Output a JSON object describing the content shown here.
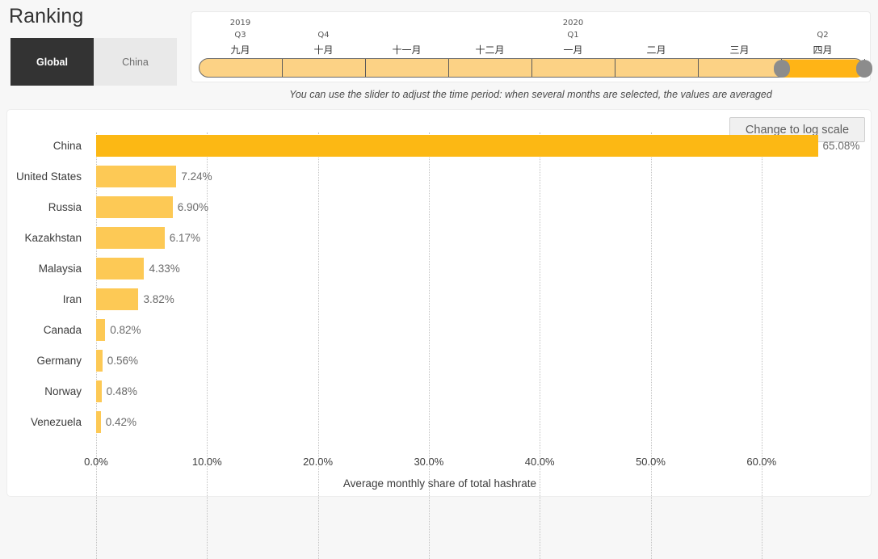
{
  "header": {
    "title": "Ranking"
  },
  "scope_toggle": {
    "options": [
      {
        "label": "Global",
        "active": true
      },
      {
        "label": "China",
        "active": false
      }
    ]
  },
  "timeline": {
    "hint": "You can use the slider to adjust the time period: when several months are selected, the values are averaged",
    "columns": [
      {
        "year": "2019",
        "quarter": "Q3",
        "month": "九月",
        "selected": false
      },
      {
        "year": "",
        "quarter": "Q4",
        "month": "十月",
        "selected": false
      },
      {
        "year": "",
        "quarter": "",
        "month": "十一月",
        "selected": false
      },
      {
        "year": "",
        "quarter": "",
        "month": "十二月",
        "selected": false
      },
      {
        "year": "2020",
        "quarter": "Q1",
        "month": "一月",
        "selected": false
      },
      {
        "year": "",
        "quarter": "",
        "month": "二月",
        "selected": false
      },
      {
        "year": "",
        "quarter": "",
        "month": "三月",
        "selected": false
      },
      {
        "year": "",
        "quarter": "Q2",
        "month": "四月",
        "selected": true
      }
    ]
  },
  "chart_panel": {
    "log_scale_button": "Change to log scale"
  },
  "chart_data": {
    "type": "bar",
    "orientation": "horizontal",
    "title": "",
    "xlabel": "Average monthly share of total hashrate",
    "ylabel": "",
    "categories": [
      "China",
      "United States",
      "Russia",
      "Kazakhstan",
      "Malaysia",
      "Iran",
      "Canada",
      "Germany",
      "Norway",
      "Venezuela"
    ],
    "values": [
      65.08,
      7.24,
      6.9,
      6.17,
      4.33,
      3.82,
      0.82,
      0.56,
      0.48,
      0.42
    ],
    "value_labels": [
      "65.08%",
      "7.24%",
      "6.90%",
      "6.17%",
      "4.33%",
      "3.82%",
      "0.82%",
      "0.56%",
      "0.48%",
      "0.42%"
    ],
    "highlight_index": 0,
    "xlim": [
      0,
      70
    ],
    "xticks": [
      0,
      10,
      20,
      30,
      40,
      50,
      60
    ],
    "xtick_labels": [
      "0.0%",
      "10.0%",
      "20.0%",
      "30.0%",
      "40.0%",
      "50.0%",
      "60.0%"
    ],
    "grid": true,
    "legend": "none",
    "colors": {
      "bar": "#fdc955",
      "bar_highlight": "#fcb814"
    }
  }
}
